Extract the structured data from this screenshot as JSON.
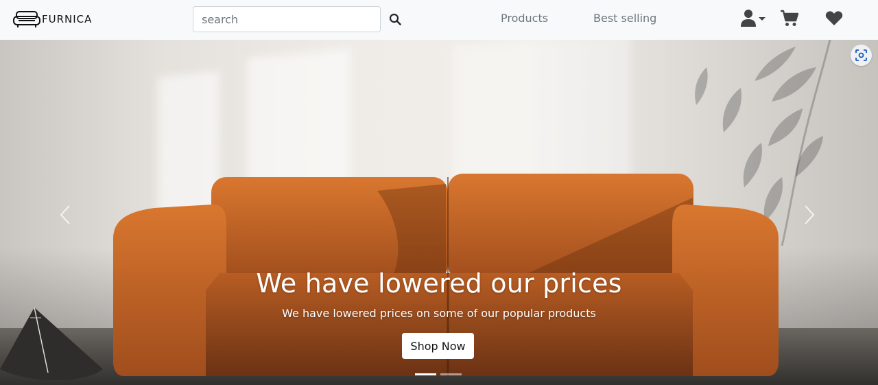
{
  "brand": {
    "name": "FURNICA"
  },
  "search": {
    "placeholder": "search",
    "value": ""
  },
  "nav": {
    "links": [
      {
        "label": "Products"
      },
      {
        "label": "Best selling"
      }
    ],
    "icons": {
      "user": "user-icon",
      "cart": "cart-icon",
      "wishlist": "heart-icon"
    }
  },
  "hero": {
    "title": "We have lowered our prices",
    "subtitle": "We have lowered prices on some of our popular products",
    "cta_label": "Shop Now",
    "slides_count": 2,
    "active_slide": 1
  },
  "colors": {
    "navbar_bg": "#f8f9fa",
    "sofa": "#c0622a",
    "text_muted": "#6c757d"
  }
}
